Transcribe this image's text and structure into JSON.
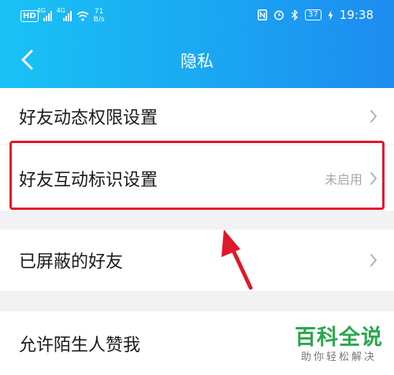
{
  "status_bar": {
    "hd_label": "HD",
    "network_1": "4G",
    "network_2": "4G",
    "speed_value": "71",
    "speed_unit": "B/s",
    "battery": "37",
    "time": "19:38"
  },
  "nav": {
    "title": "隐私",
    "back_icon": "chevron-left-icon"
  },
  "settings": [
    {
      "label": "好友动态权限设置",
      "value": ""
    },
    {
      "label": "好友互动标识设置",
      "value": "未启用"
    },
    {
      "label": "已屏蔽的好友",
      "value": ""
    },
    {
      "label": "允许陌生人赞我",
      "value": ""
    }
  ],
  "watermark": {
    "title": "百科全说",
    "subtitle": "助你轻松解决"
  },
  "colors": {
    "header_start": "#19c2f5",
    "header_end": "#1d8cf0",
    "highlight": "#e0182c",
    "watermark": "#2aa84e"
  }
}
